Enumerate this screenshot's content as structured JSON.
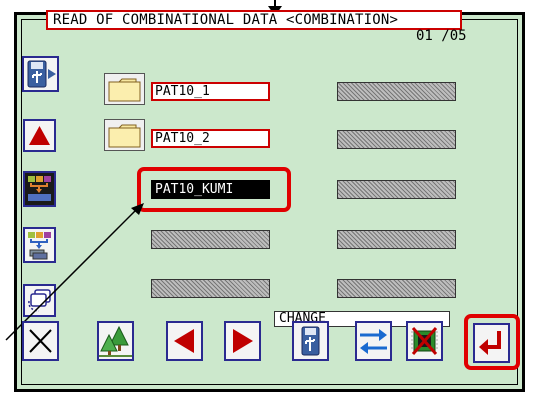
{
  "window": {
    "title": "READ OF COMBINATIONAL DATA <COMBINATION>",
    "page_indicator": "01 /05"
  },
  "files": [
    {
      "name": "PAT10_1",
      "type": "folder"
    },
    {
      "name": "PAT10_2",
      "type": "folder"
    },
    {
      "name": "PAT10_KUMI",
      "type": "combination",
      "selected": true
    }
  ],
  "empty_slots": 7,
  "sidebar": {
    "items": [
      {
        "icon": "usb-drive-icon"
      },
      {
        "icon": "triangle-up-icon"
      },
      {
        "icon": "combination-data-icon"
      },
      {
        "icon": "combination-read-icon"
      },
      {
        "icon": "copy-icon"
      }
    ]
  },
  "toolbar": {
    "change_label": "CHANGE",
    "buttons": [
      {
        "icon": "close-icon"
      },
      {
        "icon": "forest-icon"
      },
      {
        "icon": "triangle-left-icon"
      },
      {
        "icon": "triangle-right-icon"
      },
      {
        "icon": "usb-change-icon"
      },
      {
        "icon": "swap-arrows-icon"
      },
      {
        "icon": "delete-memory-icon"
      },
      {
        "icon": "enter-icon"
      }
    ]
  },
  "colors": {
    "background": "#cce8cc",
    "highlight": "#e00000",
    "icon_red": "#c00000",
    "button_border": "#2a2a90"
  }
}
